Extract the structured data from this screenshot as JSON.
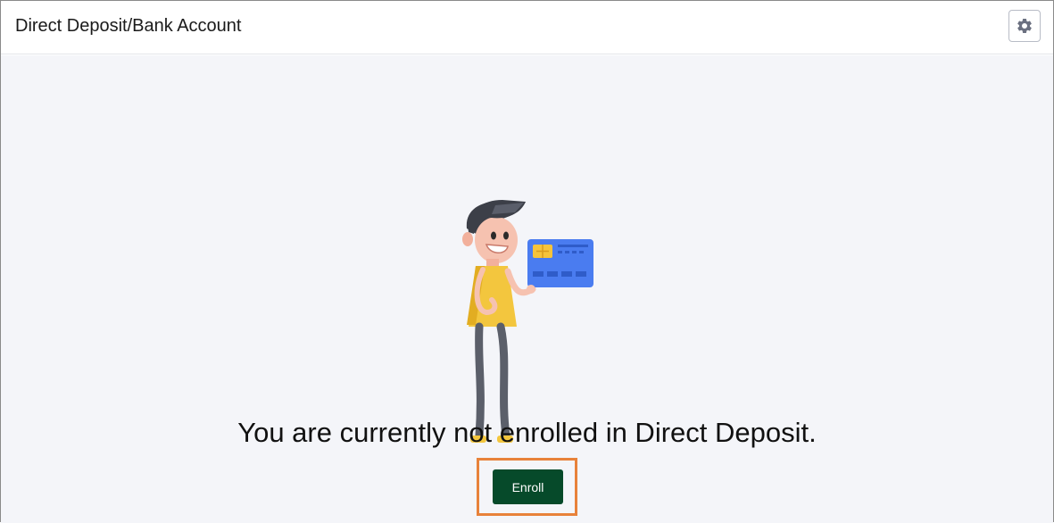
{
  "header": {
    "title": "Direct Deposit/Bank Account",
    "settings_icon": "gear-icon"
  },
  "main": {
    "illustration": "person-holding-card",
    "message": "You are currently not enrolled in Direct Deposit.",
    "enroll_label": "Enroll"
  },
  "colors": {
    "content_background": "#f4f5f9",
    "enroll_button": "#064a2a",
    "highlight_outline": "#e8823a",
    "card_blue": "#4a7cf0",
    "shirt_yellow": "#f3c63e"
  }
}
